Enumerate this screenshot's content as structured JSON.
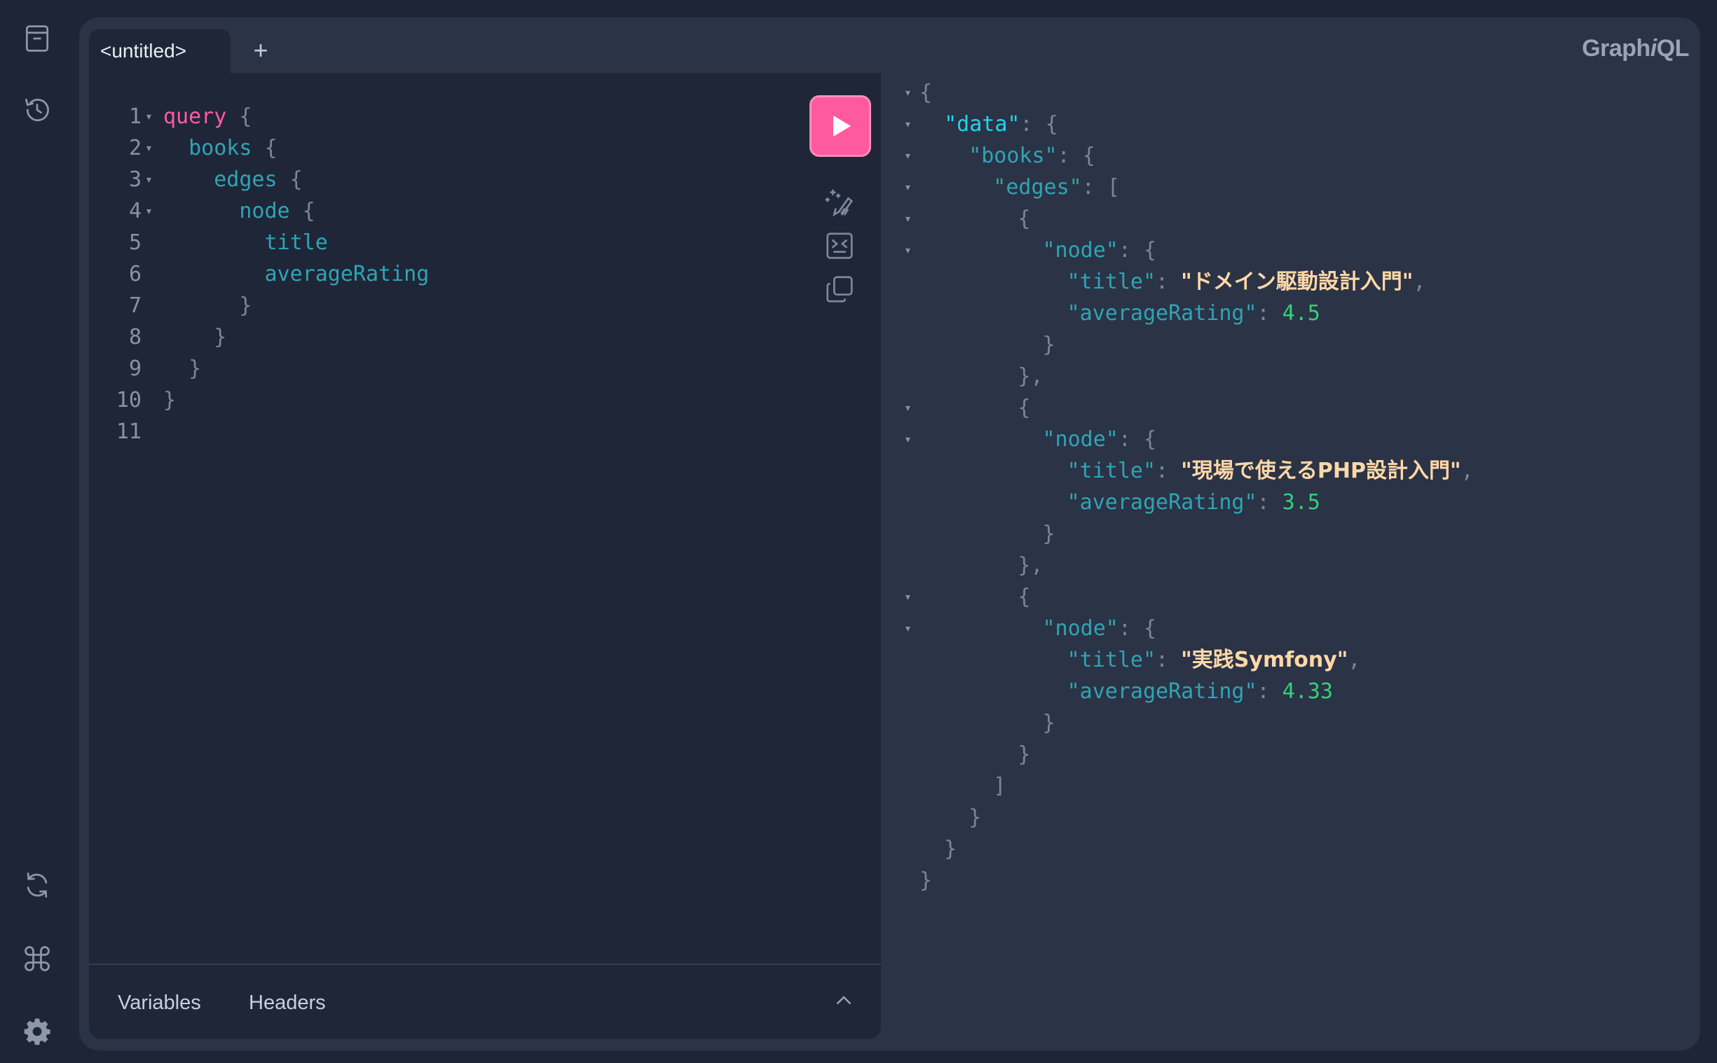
{
  "app": {
    "brand_prefix": "Graph",
    "brand_i": "i",
    "brand_suffix": "QL"
  },
  "sidebar": {
    "icons": [
      "docs-icon",
      "history-icon",
      "refetch-schema-icon",
      "shortcuts-icon",
      "settings-icon"
    ]
  },
  "tabs": [
    {
      "label": "<untitled>"
    }
  ],
  "tab_add_label": "+",
  "editor": {
    "lines": [
      {
        "n": "1",
        "fold": true,
        "tokens": [
          [
            "kw",
            "query"
          ],
          [
            "br",
            " {"
          ]
        ]
      },
      {
        "n": "2",
        "fold": true,
        "tokens": [
          [
            "fld",
            "  books"
          ],
          [
            "br",
            " {"
          ]
        ]
      },
      {
        "n": "3",
        "fold": true,
        "tokens": [
          [
            "fld",
            "    edges"
          ],
          [
            "br",
            " {"
          ]
        ]
      },
      {
        "n": "4",
        "fold": true,
        "tokens": [
          [
            "fld",
            "      node"
          ],
          [
            "br",
            " {"
          ]
        ]
      },
      {
        "n": "5",
        "fold": false,
        "tokens": [
          [
            "fld",
            "        title"
          ]
        ]
      },
      {
        "n": "6",
        "fold": false,
        "tokens": [
          [
            "fld",
            "        averageRating"
          ]
        ]
      },
      {
        "n": "7",
        "fold": false,
        "tokens": [
          [
            "br",
            "      }"
          ]
        ]
      },
      {
        "n": "8",
        "fold": false,
        "tokens": [
          [
            "br",
            "    }"
          ]
        ]
      },
      {
        "n": "9",
        "fold": false,
        "tokens": [
          [
            "br",
            "  }"
          ]
        ]
      },
      {
        "n": "10",
        "fold": false,
        "tokens": [
          [
            "br",
            "}"
          ]
        ]
      },
      {
        "n": "11",
        "fold": false,
        "tokens": []
      }
    ],
    "fold_glyph": "▾"
  },
  "toolbar": {
    "run_label": "Execute query",
    "prettify_label": "Prettify query",
    "merge_label": "Merge fragments",
    "copy_label": "Copy query"
  },
  "bottom_tabs": {
    "variables": "Variables",
    "headers": "Headers"
  },
  "result": {
    "lines": [
      {
        "indent": 0,
        "fold": true,
        "tokens": [
          [
            "punc",
            "{"
          ]
        ]
      },
      {
        "indent": 1,
        "fold": true,
        "tokens": [
          [
            "key-top",
            "\"data\""
          ],
          [
            "punc",
            ": {"
          ]
        ]
      },
      {
        "indent": 2,
        "fold": true,
        "tokens": [
          [
            "key",
            "\"books\""
          ],
          [
            "punc",
            ": {"
          ]
        ]
      },
      {
        "indent": 3,
        "fold": true,
        "tokens": [
          [
            "key",
            "\"edges\""
          ],
          [
            "punc",
            ": ["
          ]
        ]
      },
      {
        "indent": 4,
        "fold": true,
        "tokens": [
          [
            "punc",
            "{"
          ]
        ]
      },
      {
        "indent": 5,
        "fold": true,
        "tokens": [
          [
            "key",
            "\"node\""
          ],
          [
            "punc",
            ": {"
          ]
        ]
      },
      {
        "indent": 6,
        "fold": false,
        "tokens": [
          [
            "key",
            "\"title\""
          ],
          [
            "punc",
            ": "
          ],
          [
            "str",
            "\"ドメイン駆動設計入門\""
          ],
          [
            "punc",
            ","
          ]
        ]
      },
      {
        "indent": 6,
        "fold": false,
        "tokens": [
          [
            "key",
            "\"averageRating\""
          ],
          [
            "punc",
            ": "
          ],
          [
            "num",
            "4.5"
          ]
        ]
      },
      {
        "indent": 5,
        "fold": false,
        "tokens": [
          [
            "punc",
            "}"
          ]
        ]
      },
      {
        "indent": 4,
        "fold": false,
        "tokens": [
          [
            "punc",
            "},"
          ]
        ]
      },
      {
        "indent": 4,
        "fold": true,
        "tokens": [
          [
            "punc",
            "{"
          ]
        ]
      },
      {
        "indent": 5,
        "fold": true,
        "tokens": [
          [
            "key",
            "\"node\""
          ],
          [
            "punc",
            ": {"
          ]
        ]
      },
      {
        "indent": 6,
        "fold": false,
        "tokens": [
          [
            "key",
            "\"title\""
          ],
          [
            "punc",
            ": "
          ],
          [
            "str",
            "\"現場で使えるPHP設計入門\""
          ],
          [
            "punc",
            ","
          ]
        ]
      },
      {
        "indent": 6,
        "fold": false,
        "tokens": [
          [
            "key",
            "\"averageRating\""
          ],
          [
            "punc",
            ": "
          ],
          [
            "num",
            "3.5"
          ]
        ]
      },
      {
        "indent": 5,
        "fold": false,
        "tokens": [
          [
            "punc",
            "}"
          ]
        ]
      },
      {
        "indent": 4,
        "fold": false,
        "tokens": [
          [
            "punc",
            "},"
          ]
        ]
      },
      {
        "indent": 4,
        "fold": true,
        "tokens": [
          [
            "punc",
            "{"
          ]
        ]
      },
      {
        "indent": 5,
        "fold": true,
        "tokens": [
          [
            "key",
            "\"node\""
          ],
          [
            "punc",
            ": {"
          ]
        ]
      },
      {
        "indent": 6,
        "fold": false,
        "tokens": [
          [
            "key",
            "\"title\""
          ],
          [
            "punc",
            ": "
          ],
          [
            "str",
            "\"実践Symfony\""
          ],
          [
            "punc",
            ","
          ]
        ]
      },
      {
        "indent": 6,
        "fold": false,
        "tokens": [
          [
            "key",
            "\"averageRating\""
          ],
          [
            "punc",
            ": "
          ],
          [
            "num",
            "4.33"
          ]
        ]
      },
      {
        "indent": 5,
        "fold": false,
        "tokens": [
          [
            "punc",
            "}"
          ]
        ]
      },
      {
        "indent": 4,
        "fold": false,
        "tokens": [
          [
            "punc",
            "}"
          ]
        ]
      },
      {
        "indent": 3,
        "fold": false,
        "tokens": [
          [
            "punc",
            "]"
          ]
        ]
      },
      {
        "indent": 2,
        "fold": false,
        "tokens": [
          [
            "punc",
            "}"
          ]
        ]
      },
      {
        "indent": 1,
        "fold": false,
        "tokens": [
          [
            "punc",
            "}"
          ]
        ]
      },
      {
        "indent": 0,
        "fold": false,
        "tokens": [
          [
            "punc",
            "}"
          ]
        ]
      }
    ]
  },
  "colors": {
    "background": "#1e2536",
    "panel": "#2b3346",
    "editor": "#1f2638",
    "run_button": "#ff5a9f",
    "keyword": "#ff5ca1",
    "field": "#2fa4b3",
    "string": "#ffd8a8",
    "number": "#33d17a"
  }
}
